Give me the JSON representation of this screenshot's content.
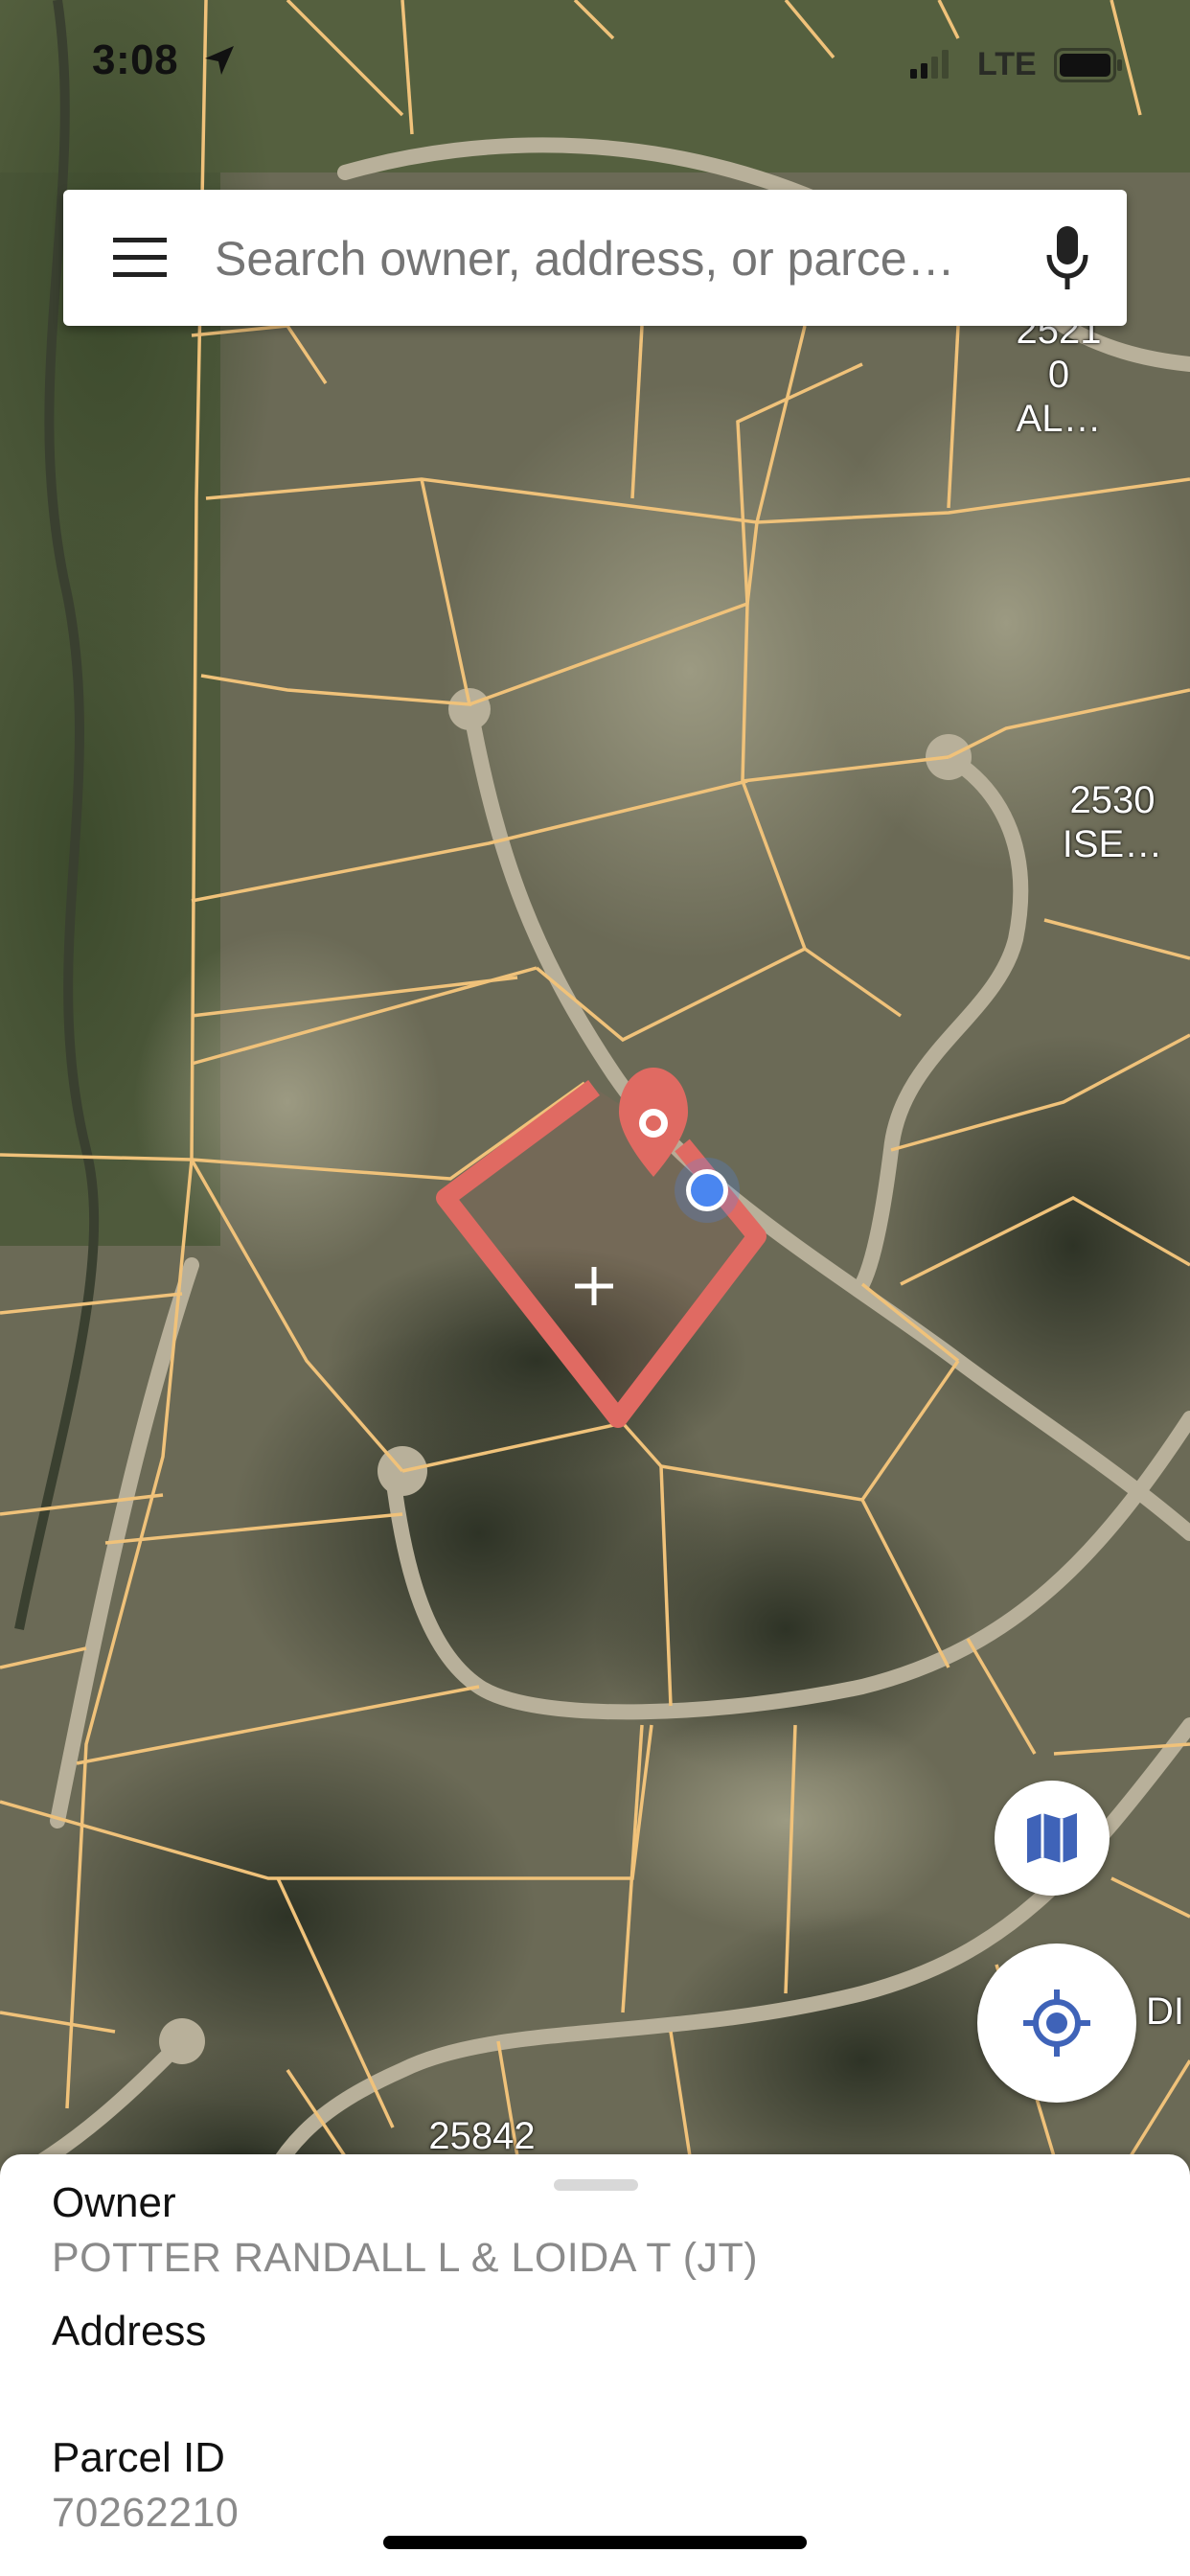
{
  "status_bar": {
    "time": "3:08",
    "network": "LTE"
  },
  "search": {
    "placeholder": "Search owner, address, or parce…"
  },
  "map": {
    "labels": [
      {
        "text": "2521\n0\nAL…"
      },
      {
        "text": "2530\nISE…"
      },
      {
        "text": "25842"
      },
      {
        "text": "DI"
      }
    ],
    "colors": {
      "parcel_lines": "#f0c27a",
      "selected_parcel": "#e06a62",
      "user_location": "#4a86f0"
    },
    "icons": [
      "location-arrow-icon",
      "signal-icon",
      "battery-icon",
      "menu-icon",
      "mic-icon",
      "map-type-icon",
      "locate-icon",
      "map-pin-icon",
      "crosshair-icon"
    ]
  },
  "parcel_sheet": {
    "owner_label": "Owner",
    "owner_value": "POTTER RANDALL L & LOIDA T (JT)",
    "address_label": "Address",
    "address_value": "",
    "parcel_label": "Parcel ID",
    "parcel_value": "70262210"
  }
}
